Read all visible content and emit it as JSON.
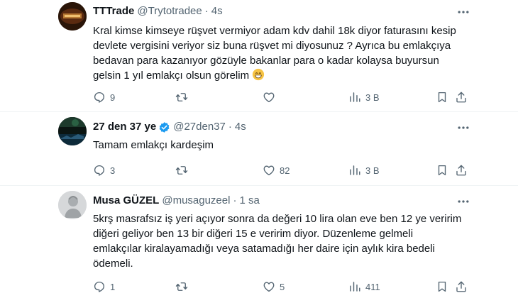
{
  "tweets": [
    {
      "name": "TTTrade",
      "handle": "@Trytotradee",
      "sep": "·",
      "time": "4s",
      "text": "Kral kimse kimseye rüşvet vermiyor adam kdv dahil 18k diyor faturasını kesip devlete vergisini veriyor siz buna rüşvet mi diyosunuz ? Ayrıca bu emlakçıya bedavan para kazanıyor gözüyle bakanlar para o kadar kolaysa buyursun gelsin 1 yıl emlakçı olsun görelim",
      "emoji": "grinning-face-emoji",
      "replies": "9",
      "reposts": "",
      "likes": "",
      "views": "3 B",
      "verified": false
    },
    {
      "name": "27 den 37 ye",
      "handle": "@27den37",
      "sep": "·",
      "time": "4s",
      "text": "Tamam emlakçı kardeşim",
      "replies": "3",
      "reposts": "",
      "likes": "82",
      "views": "3 B",
      "verified": true
    },
    {
      "name": "Musa GÜZEL",
      "handle": "@musaguzeel",
      "sep": "·",
      "time": "1 sa",
      "text": "5krş masrafsız iş yeri açıyor sonra da değeri 10 lira olan eve ben 12 ye veririm diğeri geliyor ben 13 bir diğeri 15 e veririm diyor. Düzenleme gelmeli emlakçılar kiralayamadığı veya satamadığı her daire için aylık kira bedeli ödemeli.",
      "replies": "1",
      "reposts": "",
      "likes": "5",
      "views": "411",
      "verified": false
    }
  ],
  "colors": {
    "text": "#0f1419",
    "muted": "#536471",
    "verified": "#1d9bf0",
    "divider": "#eff3f4",
    "emoji": "#f6c344"
  },
  "icons": [
    "more-icon",
    "reply-icon",
    "repost-icon",
    "like-icon",
    "views-icon",
    "bookmark-icon",
    "share-icon",
    "verified-icon"
  ]
}
